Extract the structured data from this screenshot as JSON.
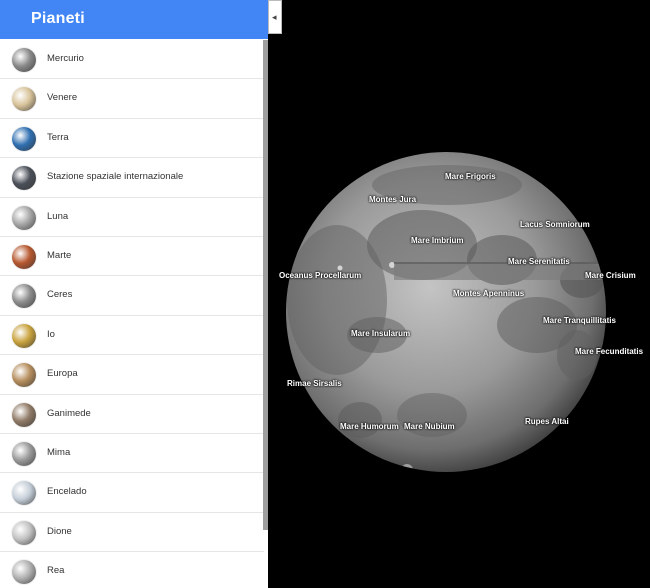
{
  "panel": {
    "title": "Pianeti",
    "items": [
      {
        "label": "Mercurio",
        "color": "#8a8a8a"
      },
      {
        "label": "Venere",
        "color": "#d8c39a"
      },
      {
        "label": "Terra",
        "color": "#2f6fb0"
      },
      {
        "label": "Stazione spaziale internazionale",
        "color": "#4a4f58"
      },
      {
        "label": "Luna",
        "color": "#a7a7a7"
      },
      {
        "label": "Marte",
        "color": "#b6572e"
      },
      {
        "label": "Ceres",
        "color": "#8c8c8c"
      },
      {
        "label": "Io",
        "color": "#c9a23d"
      },
      {
        "label": "Europa",
        "color": "#b58d5c"
      },
      {
        "label": "Ganimede",
        "color": "#8f7a66"
      },
      {
        "label": "Mima",
        "color": "#9a9a9a"
      },
      {
        "label": "Encelado",
        "color": "#c5ced8"
      },
      {
        "label": "Dione",
        "color": "#c2c2c2"
      },
      {
        "label": "Rea",
        "color": "#b1b1b1"
      }
    ]
  },
  "toggle": {
    "icon": "chevron-left-icon",
    "glyph": "◂"
  },
  "moon": {
    "labels": [
      {
        "id": "mare-frigoris",
        "text": "Mare Frigoris"
      },
      {
        "id": "montes-jura",
        "text": "Montes Jura"
      },
      {
        "id": "lacus-somniorum",
        "text": "Lacus Somniorum"
      },
      {
        "id": "mare-imbrium",
        "text": "Mare Imbrium"
      },
      {
        "id": "mare-serenitatis",
        "text": "Mare Serenitatis"
      },
      {
        "id": "oceanus-procellarum",
        "text": "Oceanus Procellarum"
      },
      {
        "id": "mare-crisium",
        "text": "Mare Crisium"
      },
      {
        "id": "montes-apenninus",
        "text": "Montes Apenninus"
      },
      {
        "id": "mare-tranquillitatis",
        "text": "Mare Tranquillitatis"
      },
      {
        "id": "mare-insularum",
        "text": "Mare Insularum"
      },
      {
        "id": "mare-fecunditatis",
        "text": "Mare Fecunditatis"
      },
      {
        "id": "rimae-sirsalis",
        "text": "Rimae Sirsalis"
      },
      {
        "id": "rupes-altai",
        "text": "Rupes Altai"
      },
      {
        "id": "mare-humorum",
        "text": "Mare Humorum"
      },
      {
        "id": "mare-nubium",
        "text": "Mare Nubium"
      }
    ]
  }
}
